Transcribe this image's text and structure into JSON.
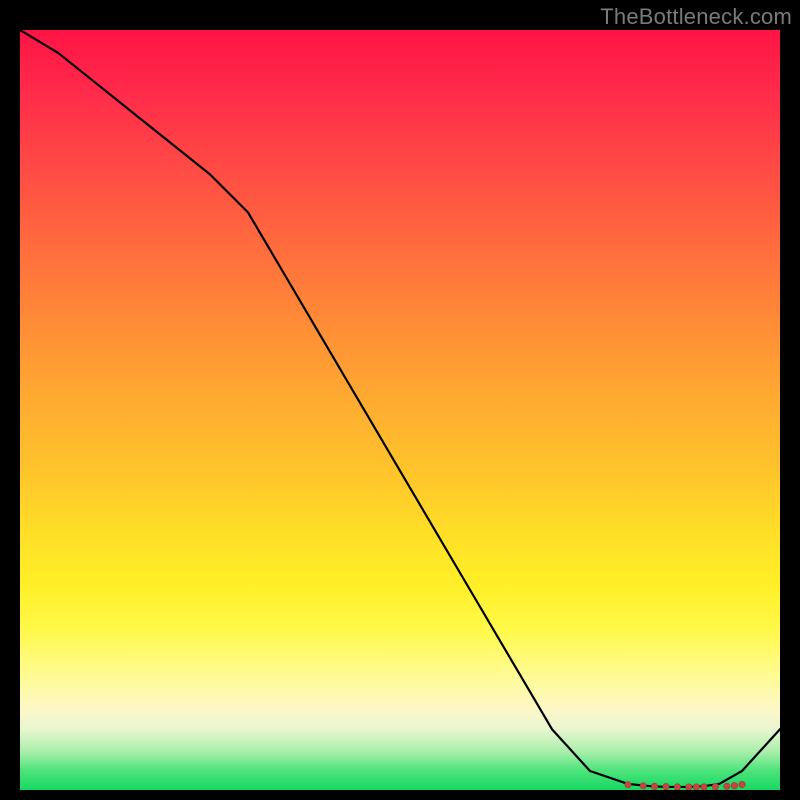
{
  "watermark": "TheBottleneck.com",
  "chart_data": {
    "type": "line",
    "title": "",
    "xlabel": "",
    "ylabel": "",
    "xlim": [
      0,
      100
    ],
    "ylim": [
      0,
      100
    ],
    "categories": [
      0,
      5,
      10,
      15,
      20,
      25,
      30,
      35,
      40,
      45,
      50,
      55,
      60,
      65,
      70,
      75,
      80,
      83,
      85,
      88,
      90,
      92,
      95,
      100
    ],
    "values": [
      100,
      97,
      93,
      89,
      85,
      81,
      76,
      67.5,
      59,
      50.5,
      42,
      33.5,
      25,
      16.5,
      8,
      2.5,
      0.8,
      0.5,
      0.4,
      0.4,
      0.5,
      0.8,
      2.5,
      8
    ],
    "markers": {
      "x": [
        80,
        82,
        83.5,
        85,
        86.5,
        88,
        89,
        90,
        91.5,
        93,
        94,
        95
      ],
      "y": [
        0.7,
        0.55,
        0.48,
        0.44,
        0.41,
        0.4,
        0.4,
        0.41,
        0.44,
        0.5,
        0.58,
        0.72
      ]
    },
    "background": "heat-gradient-red-to-green"
  }
}
